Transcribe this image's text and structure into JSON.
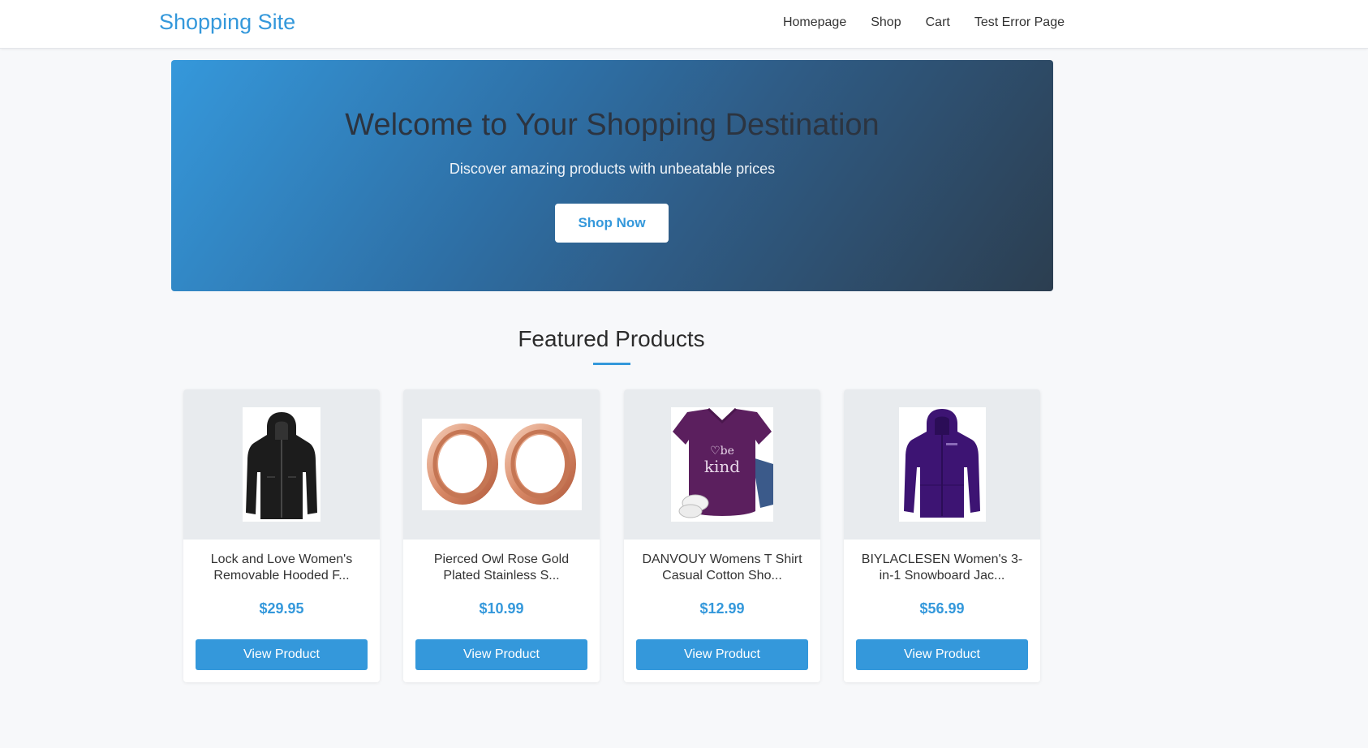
{
  "navbar": {
    "brand": "Shopping Site",
    "links": [
      "Homepage",
      "Shop",
      "Cart",
      "Test Error Page"
    ]
  },
  "hero": {
    "title": "Welcome to Your Shopping Destination",
    "subtitle": "Discover amazing products with unbeatable prices",
    "button_label": "Shop Now"
  },
  "featured": {
    "title": "Featured Products",
    "products": [
      {
        "name": "Lock and Love Women's Removable Hooded F...",
        "price": "$29.95",
        "button_label": "View Product",
        "image_icon": "leather-jacket-icon"
      },
      {
        "name": "Pierced Owl Rose Gold Plated Stainless S...",
        "price": "$10.99",
        "button_label": "View Product",
        "image_icon": "ear-tunnels-icon"
      },
      {
        "name": "DANVOUY Womens T Shirt Casual Cotton Sho...",
        "price": "$12.99",
        "button_label": "View Product",
        "image_icon": "tshirt-icon"
      },
      {
        "name": "BIYLACLESEN Women's 3-in-1 Snowboard Jac...",
        "price": "$56.99",
        "button_label": "View Product",
        "image_icon": "snowboard-jacket-icon"
      }
    ]
  },
  "colors": {
    "accent": "#3498db",
    "hero_gradient_start": "#3598db",
    "hero_gradient_end": "#2c3e50",
    "page_background": "#f7f8fa"
  }
}
